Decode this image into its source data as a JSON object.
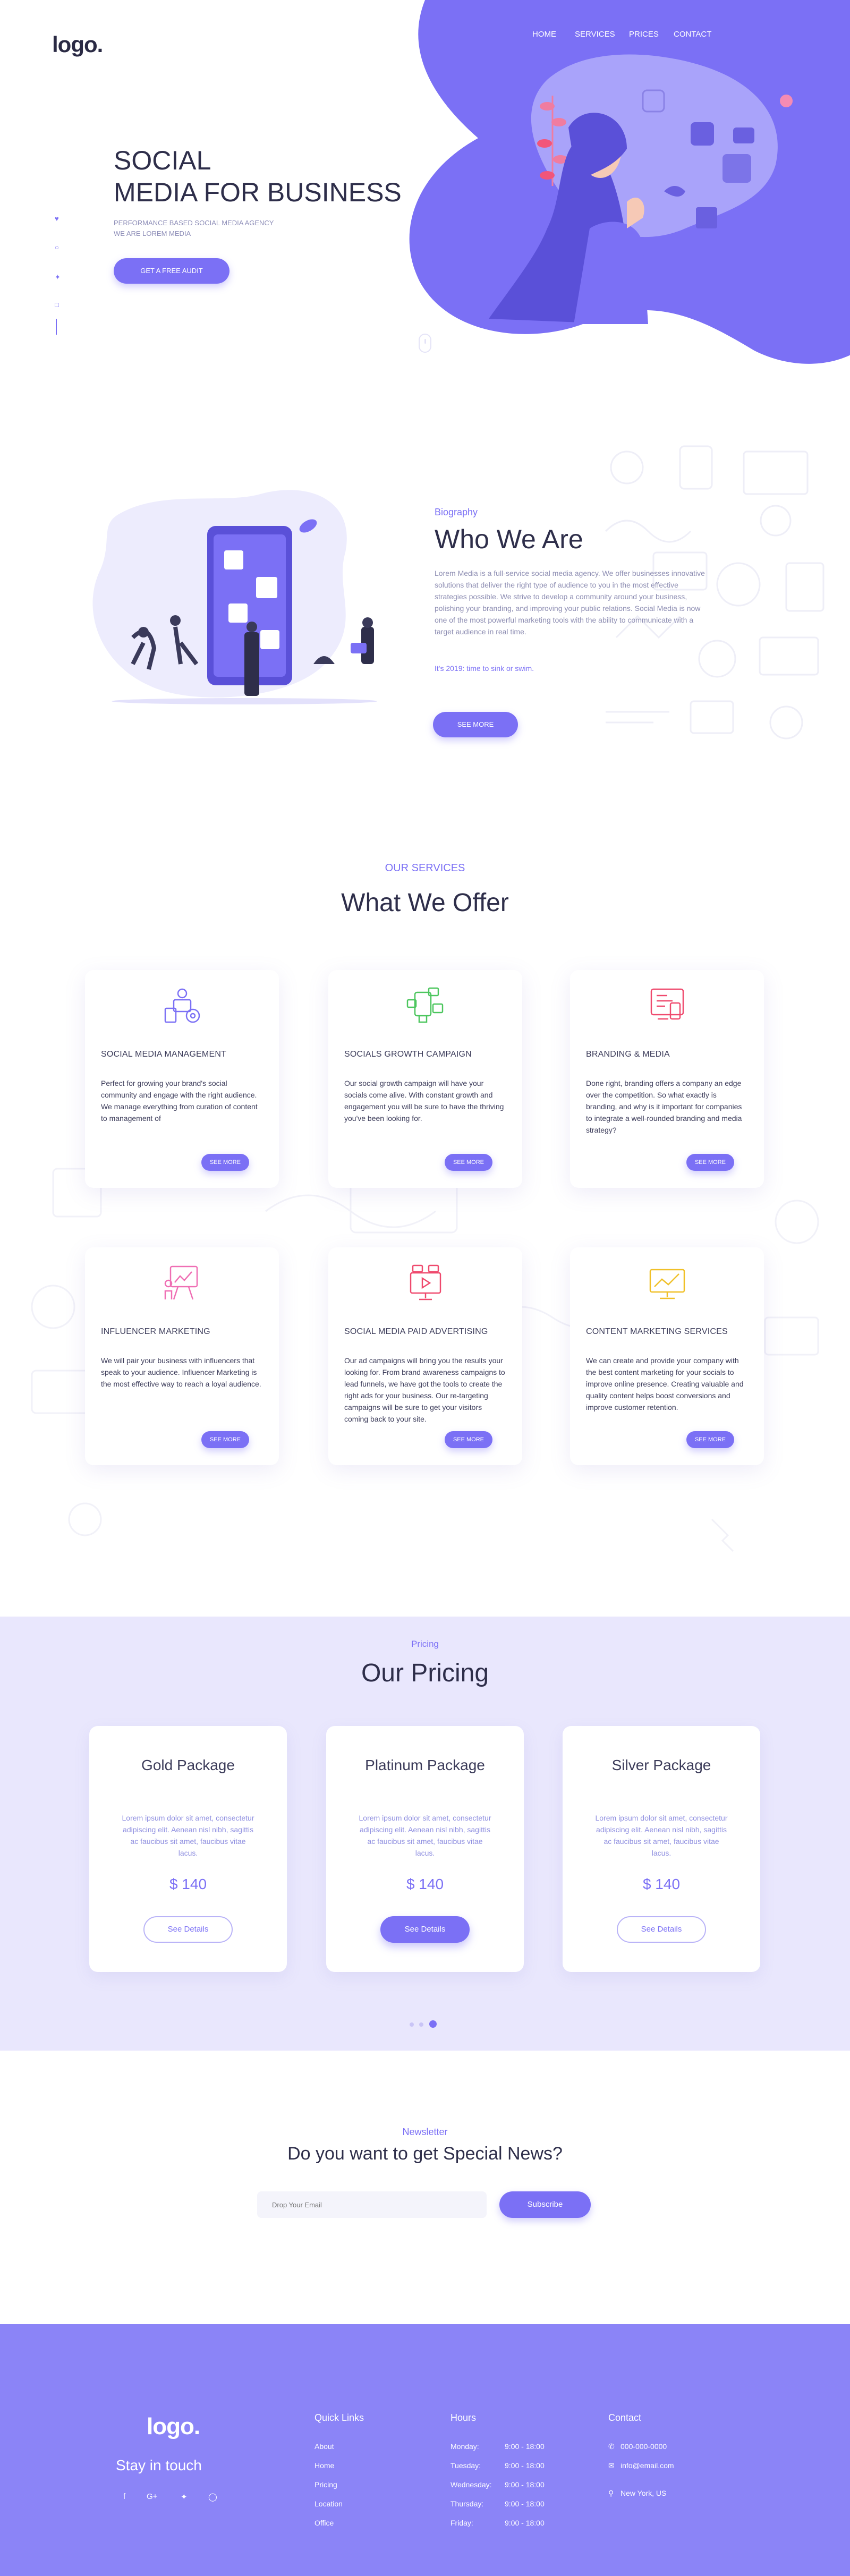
{
  "header": {
    "logo": "logo.",
    "nav": [
      "HOME",
      "SERVICES",
      "PRICES",
      "CONTACT"
    ]
  },
  "hero": {
    "title_line1": "SOCIAL",
    "title_line2": "MEDIA FOR BUSINESS",
    "subtitle_line1": "PERFORMANCE BASED SOCIAL MEDIA AGENCY",
    "subtitle_line2": "WE ARE LOREM MEDIA",
    "cta": "GET A FREE AUDIT",
    "social_icons": [
      "heart-icon",
      "pinterest-icon",
      "twitter-icon",
      "instagram-icon"
    ]
  },
  "about": {
    "label": "Biography",
    "title": "Who We Are",
    "text": "Lorem Media is a full-service social media agency. We offer businesses innovative solutions that deliver the right type of audience to you in the most effective strategies possible. We strive to develop a community around your business, polishing your branding, and improving your public relations. Social Media is now one of the most powerful marketing tools with the ability to communicate with a target audience in real time.",
    "tagline": "It's 2019: time to sink or swim.",
    "button": "SEE MORE"
  },
  "services": {
    "label": "OUR SERVICES",
    "title": "What We Offer",
    "items": [
      {
        "title": "SOCIAL MEDIA MANAGEMENT",
        "text": "Perfect for growing your brand's social community and engage with the right audience. We manage everything from curation of content to management of",
        "button": "SEE MORE",
        "icon": "management-icon",
        "color": "#7b70f5"
      },
      {
        "title": "SOCIALS GROWTH CAMPAIGN",
        "text": "Our social growth campaign will have your socials come alive. With constant growth and engagement you will be sure to have the thriving you've been looking for.",
        "button": "SEE MORE",
        "icon": "growth-icon",
        "color": "#4cc65e"
      },
      {
        "title": "BRANDING & MEDIA",
        "text": "Done right, branding offers a company an edge over the competition. So what exactly is branding, and why is it important for companies to integrate a well-rounded branding and media strategy?",
        "button": "SEE MORE",
        "icon": "branding-icon",
        "color": "#ef4a6e"
      },
      {
        "title": "INFLUENCER MARKETING",
        "text": "We will pair your business with influencers that speak to your audience. Influencer Marketing is the most effective way to reach a loyal audience.",
        "button": "SEE MORE",
        "icon": "influencer-icon",
        "color": "#ef6fb4"
      },
      {
        "title": "SOCIAL MEDIA PAID ADVERTISING",
        "text": "Our ad campaigns will bring you the results your looking for. From brand awareness campaigns to lead funnels, we have got the tools to create the right ads for your business. Our re-targeting campaigns will be sure to get your visitors coming back to your site.",
        "button": "SEE MORE",
        "icon": "advertising-icon",
        "color": "#ef4a6e"
      },
      {
        "title": "CONTENT MARKETING SERVICES",
        "text": "We can create and provide your company with the best content marketing for your socials to improve online presence. Creating valuable and quality content helps boost conversions and improve customer retention.",
        "button": "SEE MORE",
        "icon": "content-icon",
        "color": "#f0c028"
      }
    ]
  },
  "pricing": {
    "label": "Pricing",
    "title": "Our Pricing",
    "cards": [
      {
        "name": "Gold Package",
        "desc": "Lorem ipsum dolor sit amet, consectetur adipiscing elit. Aenean nisl nibh, sagittis ac faucibus sit amet, faucibus vitae lacus.",
        "price": "$ 140",
        "button": "See Details"
      },
      {
        "name": "Platinum Package",
        "desc": "Lorem ipsum dolor sit amet, consectetur adipiscing elit. Aenean nisl nibh, sagittis ac faucibus sit amet, faucibus vitae lacus.",
        "price": "$ 140",
        "button": "See Details"
      },
      {
        "name": "Silver Package",
        "desc": "Lorem ipsum dolor sit amet, consectetur adipiscing elit. Aenean nisl nibh, sagittis ac faucibus sit amet, faucibus vitae lacus.",
        "price": "$ 140",
        "button": "See Details"
      }
    ],
    "active_page": 3,
    "page_count": 3
  },
  "newsletter": {
    "label": "Newsletter",
    "title": "Do you want to get Special News?",
    "placeholder": "Drop Your Email",
    "button": "Subscribe"
  },
  "footer": {
    "logo": "logo.",
    "stay": "Stay in touch",
    "social_icons": [
      "facebook-icon",
      "google-plus-icon",
      "twitter-icon",
      "instagram-icon"
    ],
    "quick_links_title": "Quick Links",
    "quick_links": [
      "About",
      "Home",
      "Pricing",
      "Location",
      "Office"
    ],
    "hours_title": "Hours",
    "hours": [
      {
        "day": "Monday:",
        "time": "9:00 - 18:00"
      },
      {
        "day": "Tuesday:",
        "time": "9:00 - 18:00"
      },
      {
        "day": "Wednesday:",
        "time": "9:00 - 18:00"
      },
      {
        "day": "Thursday:",
        "time": "9:00 - 18:00"
      },
      {
        "day": "Friday:",
        "time": "9:00 - 18:00"
      }
    ],
    "contact_title": "Contact",
    "phone": "000-000-0000",
    "email": "info@email.com",
    "location": "New York, US"
  },
  "colors": {
    "accent": "#7b70f5",
    "pricing_bg": "#e9e7fd",
    "footer_bg": "#8b84f7",
    "heading": "#2e2e4a"
  }
}
